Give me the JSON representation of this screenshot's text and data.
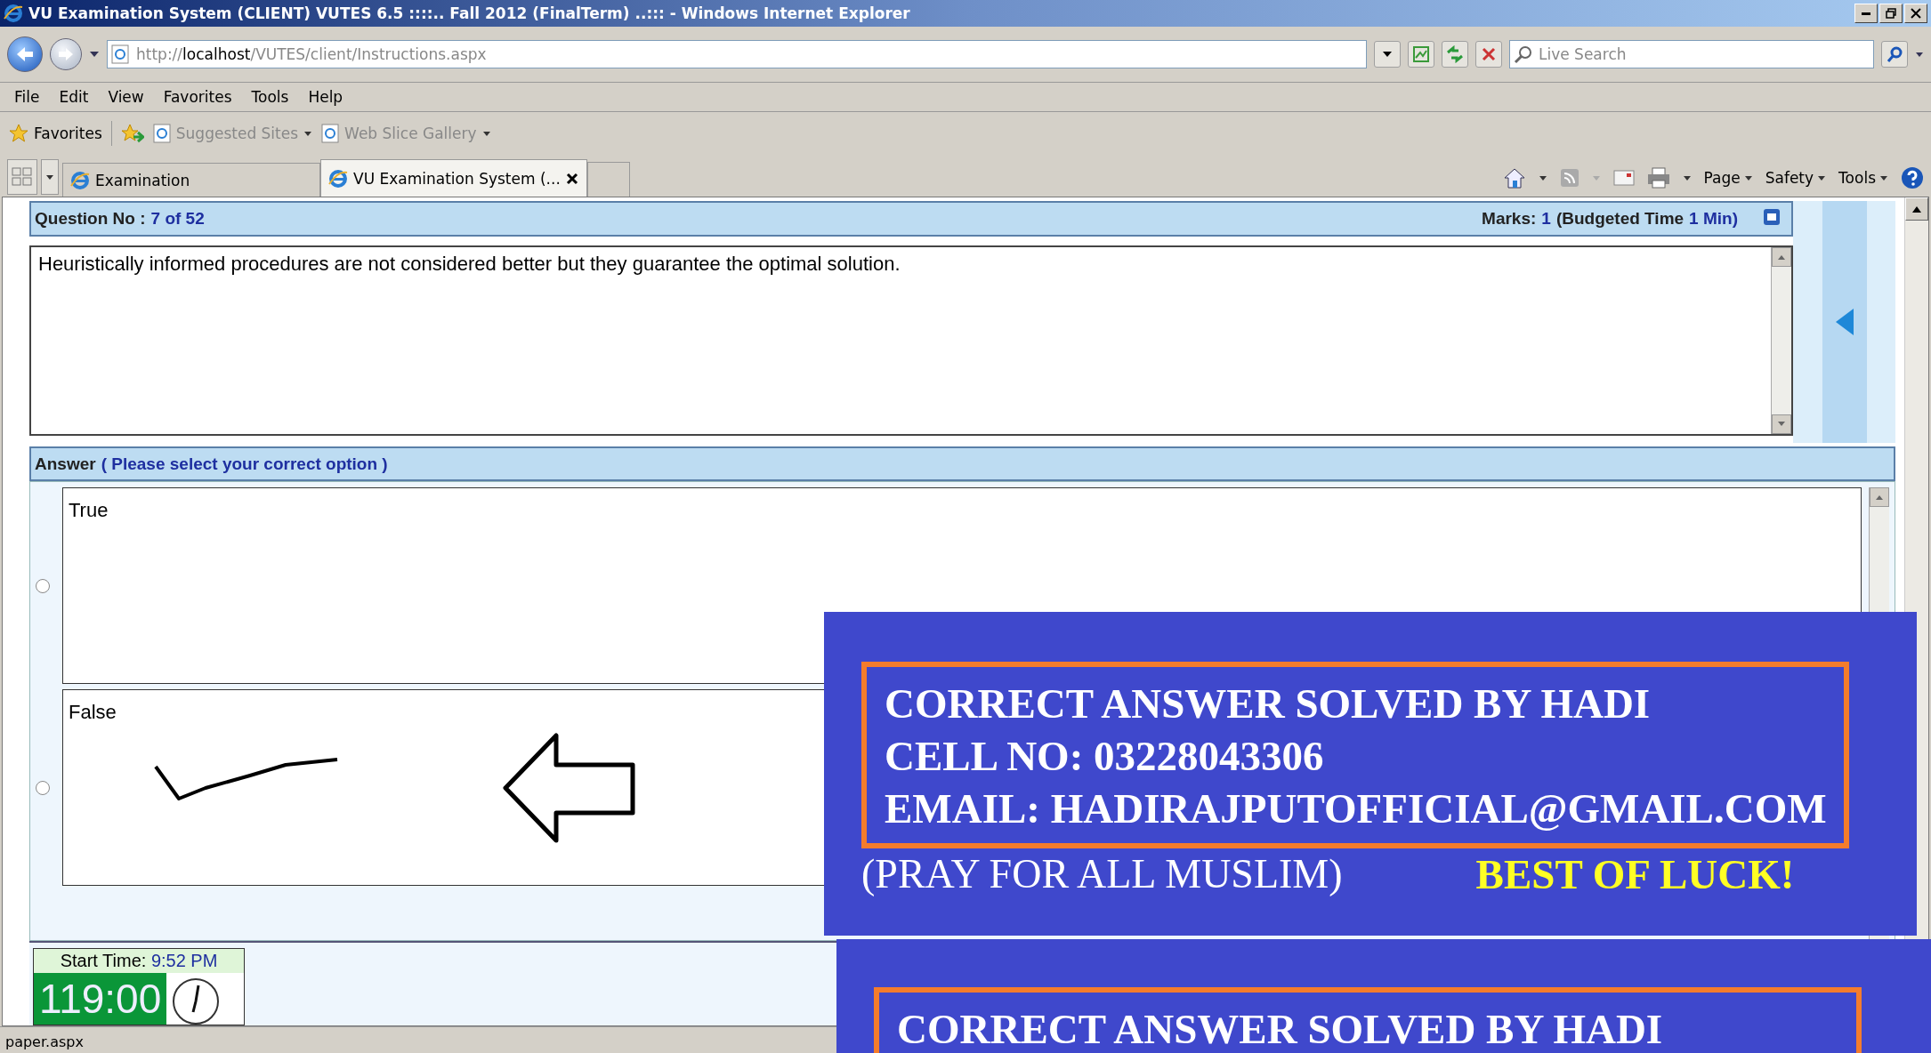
{
  "window": {
    "title": "VU Examination System (CLIENT) VUTES 6.5 ::::.. Fall 2012 (FinalTerm) ..::: - Windows Internet Explorer"
  },
  "address_bar": {
    "url": "http://**localhost**/VUTES/client/Instructions.aspx"
  },
  "search": {
    "placeholder": "Live Search"
  },
  "menu": [
    "File",
    "Edit",
    "View",
    "Favorites",
    "Tools",
    "Help"
  ],
  "favorites_bar": {
    "favorites": "Favorites",
    "links": [
      "Suggested Sites",
      "Web Slice Gallery"
    ]
  },
  "tabs": [
    {
      "label": "Examination",
      "selected": false
    },
    {
      "label": "VU Examination System (...",
      "selected": true
    }
  ],
  "command_bar": [
    "Page",
    "Safety",
    "Tools"
  ],
  "question": {
    "label": "Question No :",
    "value": "7 of 52",
    "marks": [
      {
        "kind": "label",
        "text": "Marks:"
      },
      {
        "kind": "value",
        "text": "1"
      },
      {
        "kind": "label",
        "text": "(Budgeted Time"
      },
      {
        "kind": "value",
        "text": "1 Min)"
      }
    ],
    "text": "Heuristically informed procedures are not considered better but they guarantee the optimal solution."
  },
  "answer": {
    "label": "Answer",
    "hint": "( Please select your correct option )",
    "options": [
      {
        "text": "True",
        "selected": false,
        "marked": false
      },
      {
        "text": "False",
        "selected": false,
        "marked": true
      }
    ]
  },
  "timer": {
    "label": "Start Time:",
    "start": "9:52 PM",
    "remaining": "119:00"
  },
  "status_bar": {
    "text": "paper.aspx"
  },
  "banners": [
    {
      "lines": [
        "CORRECT ANSWER SOLVED BY HADI",
        "CELL NO: 03228043306",
        "EMAIL: HADIRAJPUTOFFICIAL@GMAIL.COM"
      ],
      "note": "(PRAY FOR ALL MUSLIM)",
      "wish": "BEST OF LUCK!"
    },
    {
      "lines": [
        "CORRECT ANSWER SOLVED BY HADI"
      ]
    }
  ]
}
